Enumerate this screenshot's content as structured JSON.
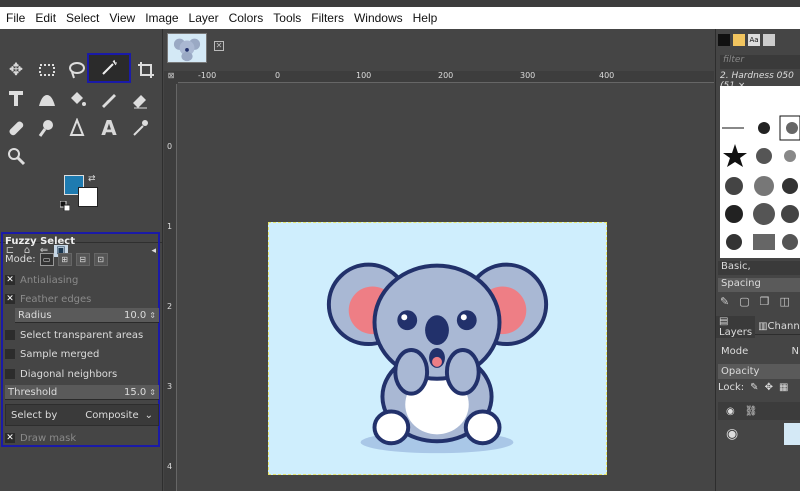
{
  "menu": [
    "File",
    "Edit",
    "Select",
    "View",
    "Image",
    "Layer",
    "Colors",
    "Tools",
    "Filters",
    "Windows",
    "Help"
  ],
  "colors": {
    "foreground": "#1e7bb0",
    "background": "#ffffff",
    "highlight": "#1a1aa8"
  },
  "tool_options": {
    "title": "Fuzzy Select",
    "mode_label": "Mode:",
    "antialiasing": {
      "label": "Antialiasing",
      "checked": true
    },
    "feather_edges": {
      "label": "Feather edges",
      "checked": true
    },
    "radius": {
      "label": "Radius",
      "value": "10.0"
    },
    "select_transparent": {
      "label": "Select transparent areas",
      "checked": false
    },
    "sample_merged": {
      "label": "Sample merged",
      "checked": false
    },
    "diagonal_neighbors": {
      "label": "Diagonal neighbors",
      "checked": false
    },
    "threshold": {
      "label": "Threshold",
      "value": "15.0"
    },
    "select_by": {
      "label": "Select by",
      "value": "Composite"
    },
    "draw_mask": {
      "label": "Draw mask",
      "checked": true
    }
  },
  "ruler": {
    "top": [
      "-100",
      "0",
      "100",
      "200",
      "300",
      "400"
    ],
    "left": [
      "0",
      "1",
      "2",
      "3",
      "4"
    ]
  },
  "brushes": {
    "filter_placeholder": "filter",
    "selected": "2. Hardness 050 (51 ×",
    "set": "Basic,",
    "spacing_label": "Spacing"
  },
  "layers": {
    "tab_layers": "Layers",
    "tab_channels": "Channe",
    "mode_label": "Mode",
    "mode_value": "N",
    "opacity_label": "Opacity",
    "lock_label": "Lock:"
  }
}
